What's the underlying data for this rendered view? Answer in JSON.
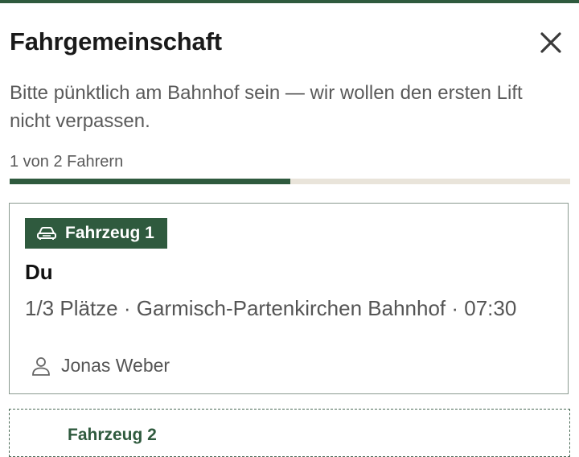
{
  "header": {
    "title": "Fahrgemeinschaft",
    "close_icon": "close-icon"
  },
  "notice": "Bitte pünktlich am Bahnhof sein — wir wollen den ersten Lift nicht verpassen.",
  "progress": {
    "label": "1 von 2 Fahrern",
    "current": 1,
    "total": 2,
    "fraction": 0.5
  },
  "vehicles": [
    {
      "badge": "Fahrzeug 1",
      "badge_icon": "car-icon",
      "driver": "Du",
      "details": "1/3 Plätze · Garmisch-Partenkirchen Bahnhof · 07:30",
      "passengers": [
        {
          "icon": "person-icon",
          "name": "Jonas Weber"
        }
      ]
    },
    {
      "badge": "Fahrzeug 2"
    }
  ],
  "colors": {
    "accent": "#2f5a3e",
    "track": "#e9e4da",
    "muted_text": "#5a5a5a",
    "card_border": "#8a9a90"
  }
}
